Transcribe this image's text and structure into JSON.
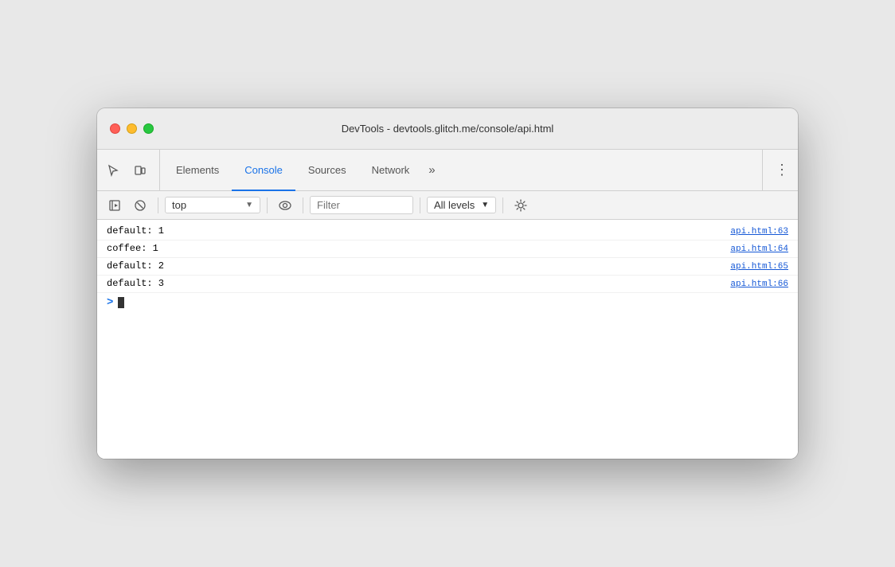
{
  "window": {
    "title": "DevTools - devtools.glitch.me/console/api.html"
  },
  "toolbar": {
    "tabs": [
      {
        "id": "elements",
        "label": "Elements",
        "active": false
      },
      {
        "id": "console",
        "label": "Console",
        "active": true
      },
      {
        "id": "sources",
        "label": "Sources",
        "active": false
      },
      {
        "id": "network",
        "label": "Network",
        "active": false
      }
    ],
    "more_label": "»",
    "menu_label": "⋮"
  },
  "console_toolbar": {
    "context": "top",
    "filter_placeholder": "Filter",
    "levels_label": "All levels"
  },
  "console": {
    "rows": [
      {
        "message": "default: 1",
        "source": "api.html:63"
      },
      {
        "message": "coffee: 1",
        "source": "api.html:64"
      },
      {
        "message": "default: 2",
        "source": "api.html:65"
      },
      {
        "message": "default: 3",
        "source": "api.html:66"
      }
    ],
    "prompt_symbol": ">"
  },
  "colors": {
    "active_tab": "#1a73e8",
    "link": "#1558d6"
  }
}
